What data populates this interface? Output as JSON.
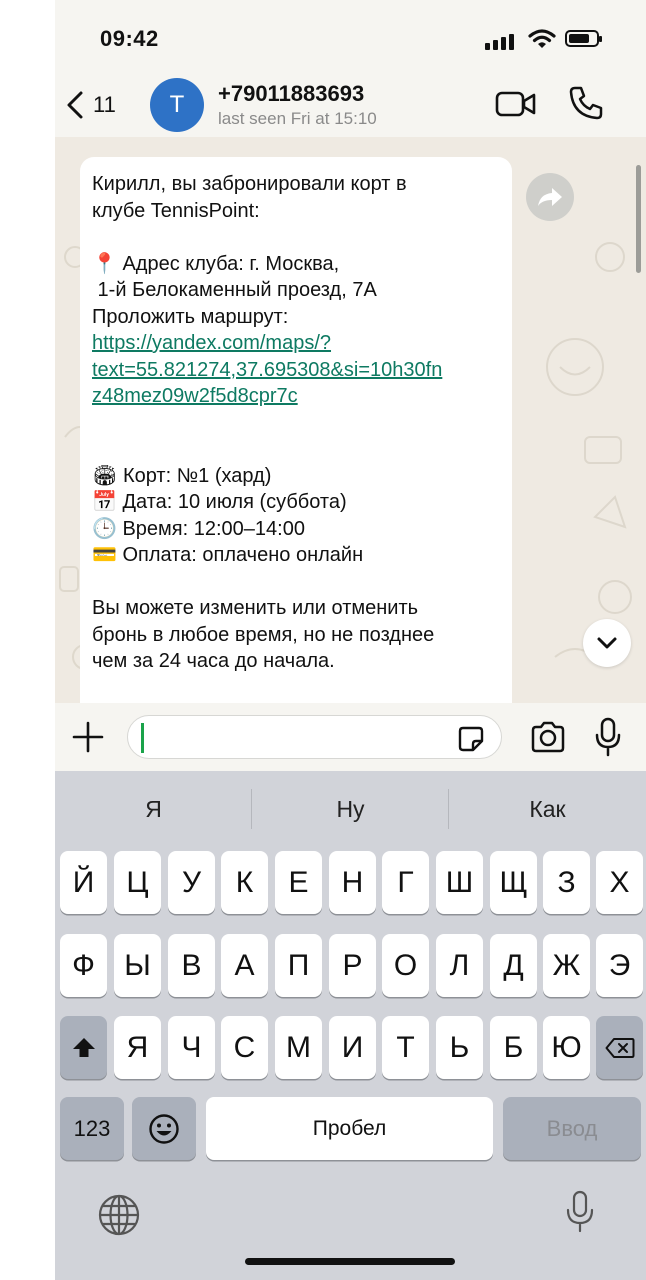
{
  "status_bar": {
    "time": "09:42"
  },
  "header": {
    "back_count": "11",
    "avatar_initial": "T",
    "contact_name": "+79011883693",
    "contact_status": "last seen Fri at 15:10"
  },
  "message": {
    "lines": [
      "Кирилл, вы забронировали корт в",
      "клубе TennisPoint:",
      "📍 Адрес клуба: г. Москва,",
      " 1-й Белокаменный проезд, 7А",
      "Проложить маршрут:",
      "https://yandex.com/maps/?",
      "text=55.821274,37.695308&si=10h30fn",
      "z48mez09w2f5d8cpr7c",
      "🏟 Корт: №1 (хард)",
      "📅 Дата: 10 июля (суббота)",
      "🕒 Время: 12:00–14:00",
      "💳 Оплата: оплачено онлайн",
      "Вы можете изменить или отменить",
      "бронь в любое время, но не позднее",
      "чем за 24 часа до начала."
    ]
  },
  "keyboard": {
    "suggestions": [
      "Я",
      "Ну",
      "Как"
    ],
    "row1": [
      "Й",
      "Ц",
      "У",
      "К",
      "Е",
      "Н",
      "Г",
      "Ш",
      "Щ",
      "З",
      "Х"
    ],
    "row2": [
      "Ф",
      "Ы",
      "В",
      "А",
      "П",
      "Р",
      "О",
      "Л",
      "Д",
      "Ж",
      "Э"
    ],
    "row3": [
      "Я",
      "Ч",
      "С",
      "М",
      "И",
      "Т",
      "Ь",
      "Б",
      "Ю"
    ],
    "numbers_label": "123",
    "space_label": "Пробел",
    "enter_label": "Ввод"
  },
  "colors": {
    "link": "#0e7a62",
    "avatar": "#2e72c6",
    "cursor": "#1aa34a"
  }
}
